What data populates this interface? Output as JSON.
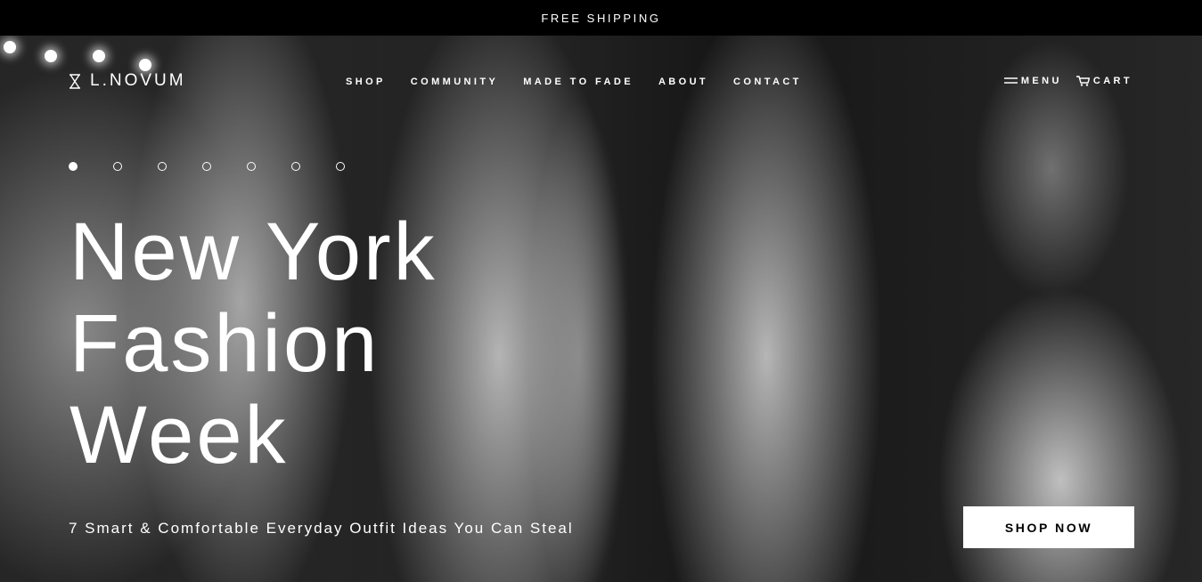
{
  "topbar": {
    "text": "FREE SHIPPING"
  },
  "brand": {
    "name": "L.NOVUM",
    "logo_icon": "hourglass-icon"
  },
  "nav": {
    "items": [
      {
        "label": "SHOP"
      },
      {
        "label": "COMMUNITY"
      },
      {
        "label": "MADE TO FADE"
      },
      {
        "label": "ABOUT"
      },
      {
        "label": "CONTACT"
      }
    ]
  },
  "right_nav": {
    "menu_label": "MENU",
    "menu_icon": "hamburger-icon",
    "cart_label": "CART",
    "cart_icon": "cart-icon"
  },
  "slider": {
    "total": 7,
    "active_index": 0
  },
  "hero": {
    "headline_line1": "New York",
    "headline_line2": "Fashion",
    "headline_line3": "Week",
    "subtitle": "7 Smart & Comfortable Everyday Outfit Ideas You Can Steal",
    "cta_label": "SHOP NOW"
  },
  "colors": {
    "background": "#000000",
    "text": "#ffffff",
    "button_bg": "#ffffff",
    "button_text": "#000000"
  }
}
